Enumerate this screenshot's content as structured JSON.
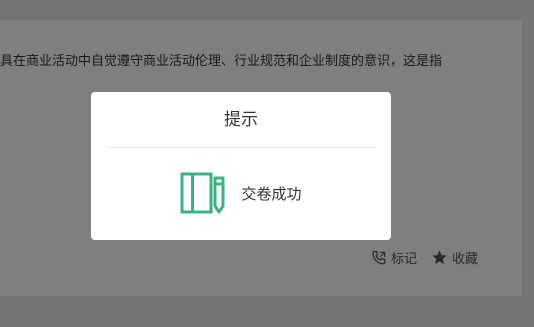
{
  "question": {
    "text": "具在商业活动中自觉遵守商业活动伦理、行业规范和企业制度的意识，这是指"
  },
  "actions": {
    "mark_label": "标记",
    "favorite_label": "收藏"
  },
  "modal": {
    "title": "提示",
    "message": "交卷成功",
    "icon": "exam-paper-pencil-icon",
    "accent_color": "#3cb37f"
  }
}
